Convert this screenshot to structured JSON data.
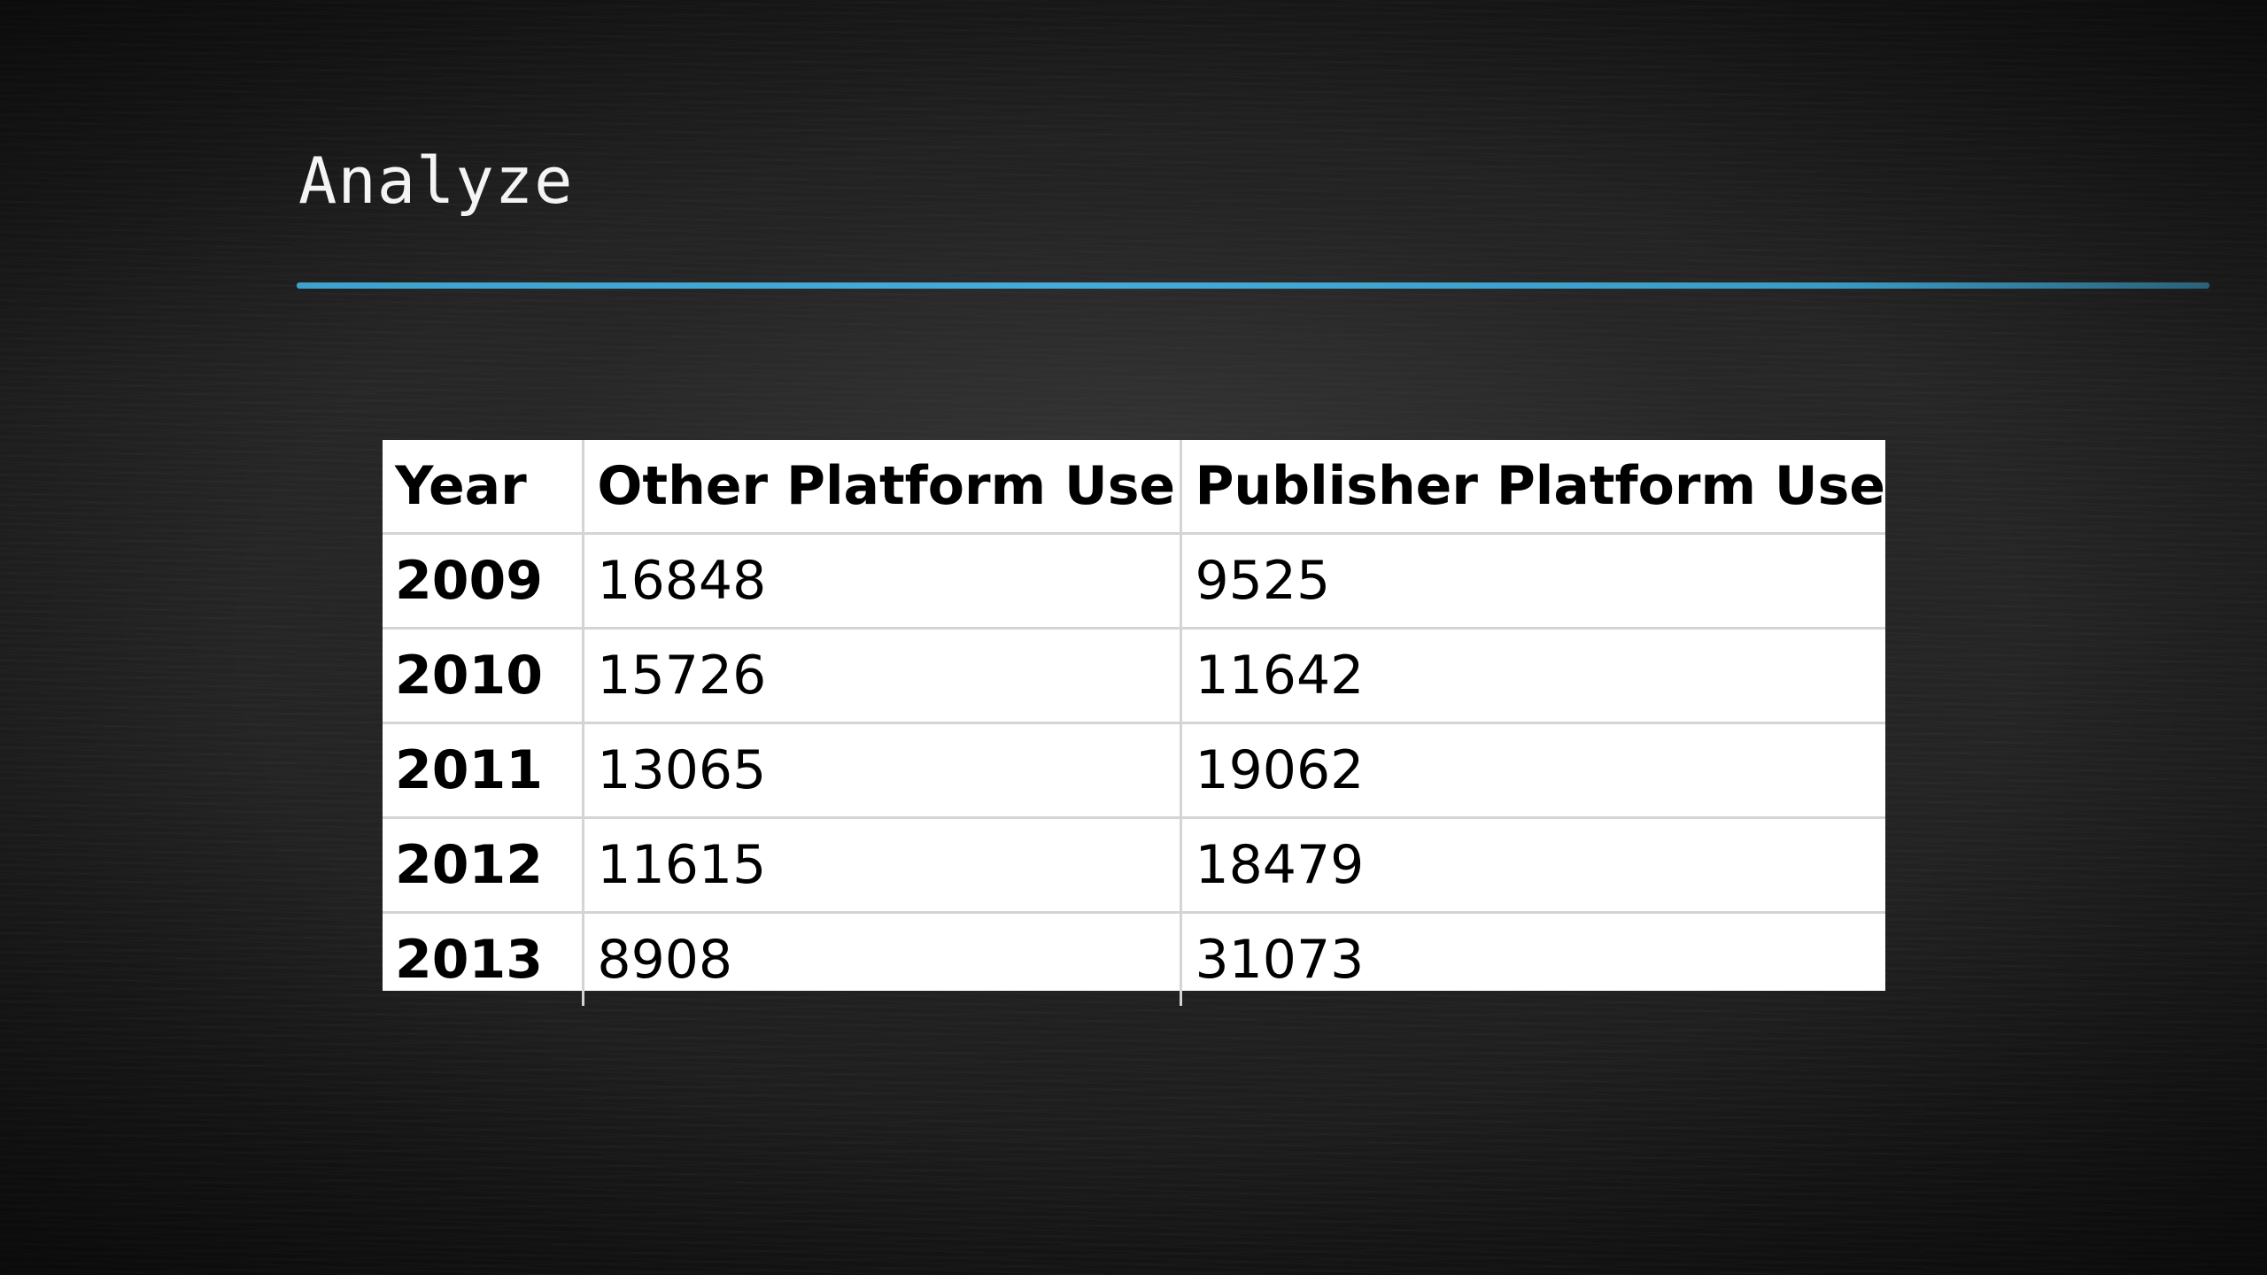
{
  "slide": {
    "title": "Analyze",
    "accent_color": "#45b3e0"
  },
  "table": {
    "headers": [
      "Year",
      "Other Platform Use",
      "Publisher Platform Use"
    ],
    "rows": [
      [
        "2009",
        "16848",
        "9525"
      ],
      [
        "2010",
        "15726",
        "11642"
      ],
      [
        "2011",
        "13065",
        "19062"
      ],
      [
        "2012",
        "11615",
        "18479"
      ],
      [
        "2013",
        "8908",
        "31073"
      ]
    ]
  }
}
